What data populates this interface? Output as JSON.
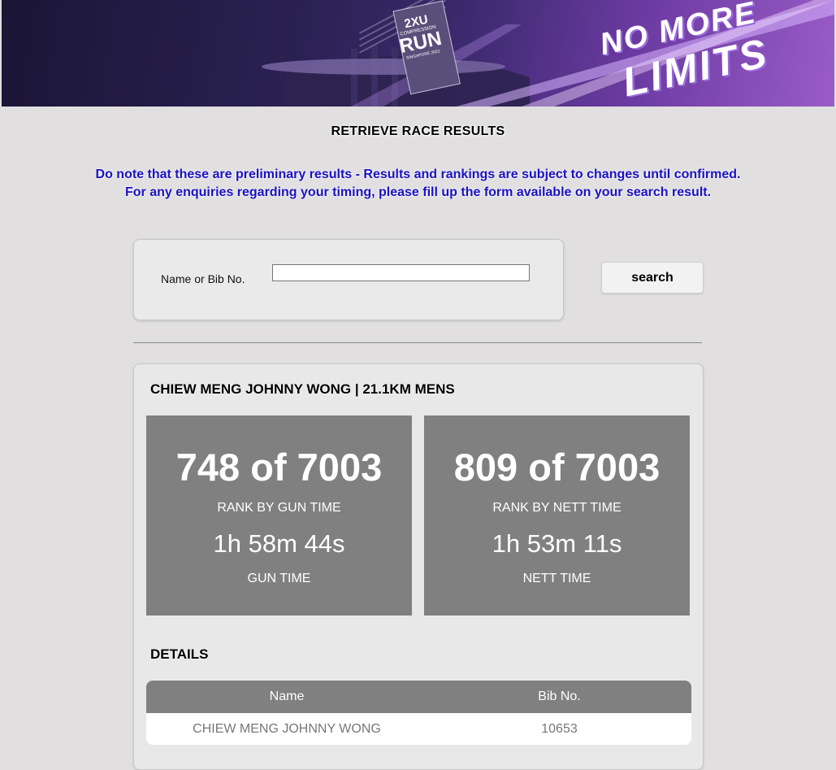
{
  "banner": {
    "brand": "2XU",
    "event_line1": "COMPRESSION",
    "event_line2": "RUN",
    "event_line3": "SINGAPORE 2022",
    "slogan1": "NO MORE",
    "slogan2": "LIMITS"
  },
  "page_title": "RETRIEVE RACE RESULTS",
  "notice": {
    "line1": "Do note that these are preliminary results - Results and rankings are subject to changes until confirmed.",
    "line2": "For any enquiries regarding your timing, please fill up the form available on your search result."
  },
  "search": {
    "label": "Name or Bib No.",
    "value": "",
    "button_label": "search"
  },
  "result": {
    "heading": "CHIEW MENG JOHNNY WONG | 21.1KM MENS",
    "gun": {
      "rank": "748 of 7003",
      "rank_label": "RANK BY GUN TIME",
      "time": "1h 58m 44s",
      "time_label": "GUN TIME"
    },
    "nett": {
      "rank": "809 of 7003",
      "rank_label": "RANK BY NETT TIME",
      "time": "1h 53m 11s",
      "time_label": "NETT TIME"
    }
  },
  "details": {
    "heading": "DETAILS",
    "columns": [
      "Name",
      "Bib No."
    ],
    "rows": [
      [
        "CHIEW MENG JOHNNY WONG",
        "10653"
      ]
    ]
  },
  "colors": {
    "background": "#e1dfe0",
    "notice": "#1a12c4",
    "stat_box": "#808080"
  }
}
